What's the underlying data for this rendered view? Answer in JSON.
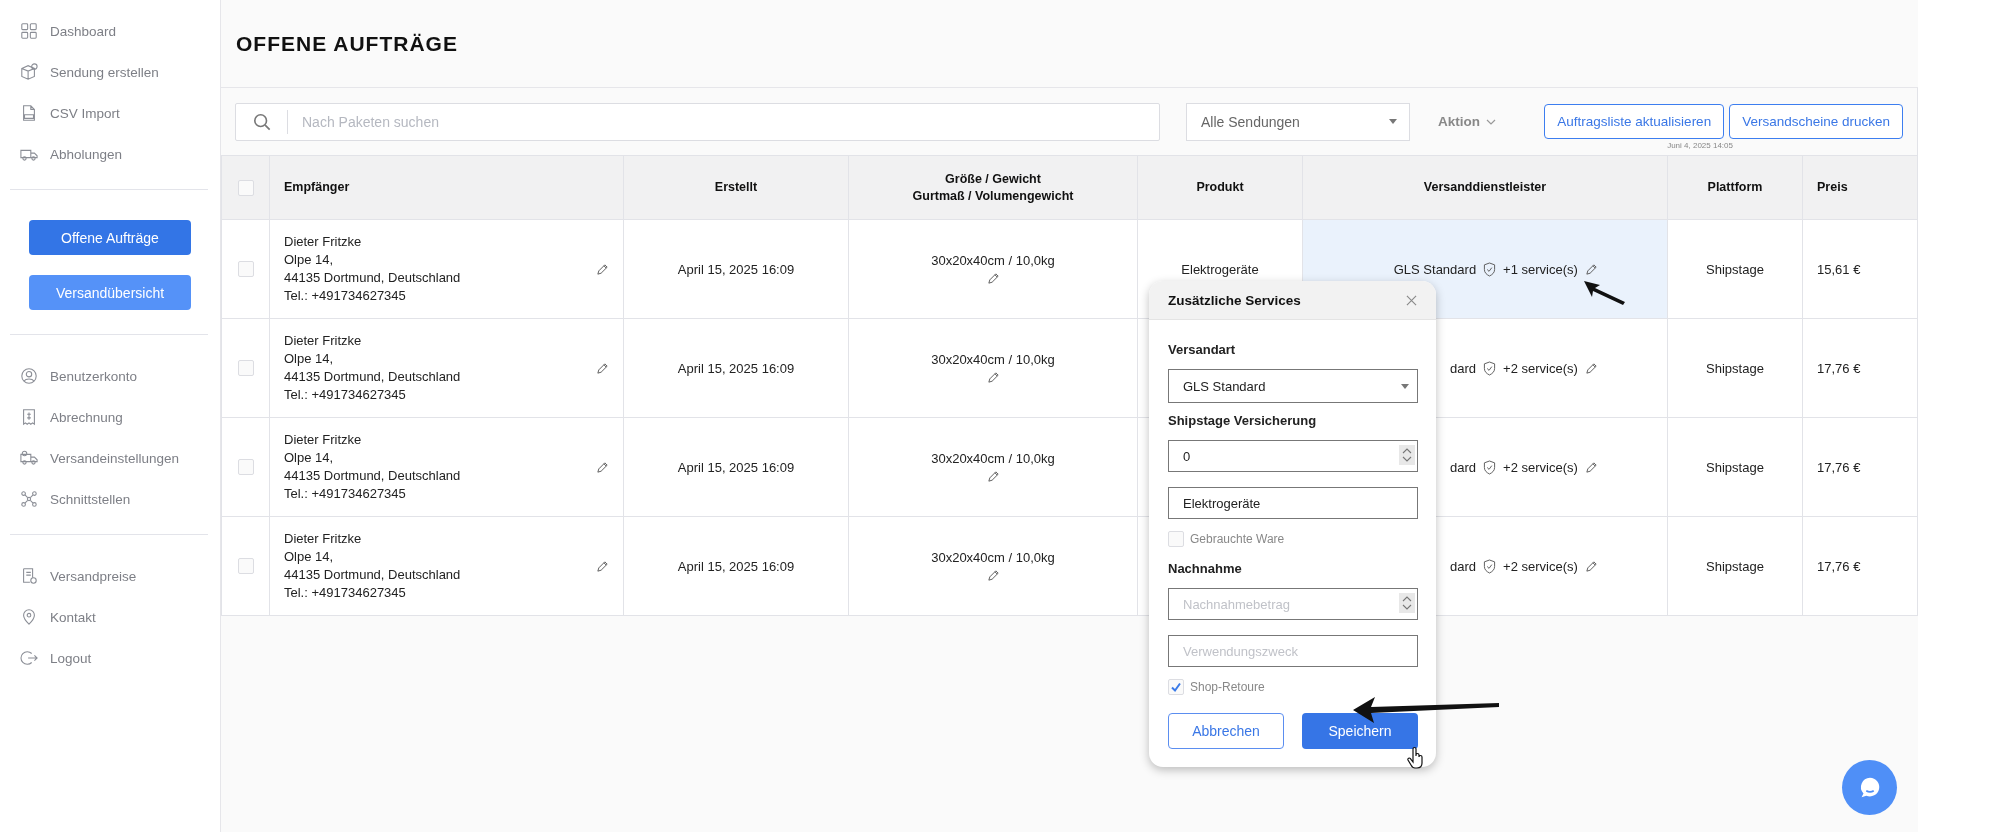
{
  "sidebar": {
    "top_items": [
      {
        "label": "Dashboard"
      },
      {
        "label": "Sendung erstellen"
      },
      {
        "label": "CSV Import"
      },
      {
        "label": "Abholungen"
      }
    ],
    "buttons": [
      {
        "label": "Offene Aufträge",
        "selected": true
      },
      {
        "label": "Versandübersicht",
        "selected": false
      }
    ],
    "account_items": [
      {
        "label": "Benutzerkonto"
      },
      {
        "label": "Abrechnung"
      },
      {
        "label": "Versandeinstellungen"
      },
      {
        "label": "Schnittstellen"
      }
    ],
    "bottom_items": [
      {
        "label": "Versandpreise"
      },
      {
        "label": "Kontakt"
      },
      {
        "label": "Logout"
      }
    ]
  },
  "page_title": "OFFENE AUFTRÄGE",
  "toolbar": {
    "search": {
      "placeholder": "Nach Paketen suchen"
    },
    "filter": "Alle Sendungen",
    "action": "Aktion",
    "buttons": [
      "Auftragsliste aktualisieren",
      "Versandscheine drucken"
    ],
    "timestamp": "Juni 4, 2025 14:05"
  },
  "table": {
    "select_all": {
      "checked": false
    },
    "columns": [
      {
        "label": "Empfänger"
      },
      {
        "label": "Erstellt"
      },
      {
        "label": "Größe / Gewicht",
        "sublabel": "Gurtmaß / Volumengewicht"
      },
      {
        "label": "Produkt"
      },
      {
        "label": "Versanddienstleister"
      },
      {
        "label": "Plattform"
      },
      {
        "label": "Preis"
      }
    ],
    "rows": [
      {
        "checked": false,
        "recipient": [
          "Dieter Fritzke",
          "Olpe 14,",
          "44135 Dortmund, Deutschland",
          "Tel.: +491734627345"
        ],
        "created": "April 15, 2025 16:09",
        "size": "30x20x40cm / 10,0kg",
        "product": "Elektrogeräte",
        "carrier": "GLS Standard",
        "services": "+1 service(s)",
        "platform": "Shipstage",
        "price": "15,61 €",
        "highlighted": true
      },
      {
        "checked": false,
        "recipient": [
          "Dieter Fritzke",
          "Olpe 14,",
          "44135 Dortmund, Deutschland",
          "Tel.: +491734627345"
        ],
        "created": "April 15, 2025 16:09",
        "size": "30x20x40cm / 10,0kg",
        "carrier": "dard",
        "services": "+2 service(s)",
        "platform": "Shipstage",
        "price": "17,76 €",
        "highlighted": false
      },
      {
        "checked": false,
        "recipient": [
          "Dieter Fritzke",
          "Olpe 14,",
          "44135 Dortmund, Deutschland",
          "Tel.: +491734627345"
        ],
        "created": "April 15, 2025 16:09",
        "size": "30x20x40cm / 10,0kg",
        "carrier": "dard",
        "services": "+2 service(s)",
        "platform": "Shipstage",
        "price": "17,76 €",
        "highlighted": false
      },
      {
        "checked": false,
        "recipient": [
          "Dieter Fritzke",
          "Olpe 14,",
          "44135 Dortmund, Deutschland",
          "Tel.: +491734627345"
        ],
        "created": "April 15, 2025 16:09",
        "size": "30x20x40cm / 10,0kg",
        "carrier": "dard",
        "services": "+2 service(s)",
        "platform": "Shipstage",
        "price": "17,76 €",
        "highlighted": false
      }
    ]
  },
  "popup": {
    "title": "Zusätzliche Services",
    "items": [
      {
        "kind": "heading",
        "label": "Versandart"
      },
      {
        "kind": "select",
        "value": "GLS Standard"
      },
      {
        "kind": "heading",
        "label": "Shipstage Versicherung"
      },
      {
        "kind": "number",
        "value": "0"
      },
      {
        "kind": "text",
        "value": "Elektrogeräte"
      },
      {
        "kind": "checkbox",
        "label": "Gebrauchte Ware",
        "checked": false
      },
      {
        "kind": "heading",
        "label": "Nachnahme"
      },
      {
        "kind": "number",
        "placeholder": "Nachnahmebetrag"
      },
      {
        "kind": "text",
        "placeholder": "Verwendungszweck"
      },
      {
        "kind": "checkbox",
        "label": "Shop-Retoure",
        "checked": true
      }
    ],
    "buttons": [
      {
        "label": "Abbrechen",
        "kind": "secondary"
      },
      {
        "label": "Speichern",
        "kind": "primary"
      }
    ]
  }
}
